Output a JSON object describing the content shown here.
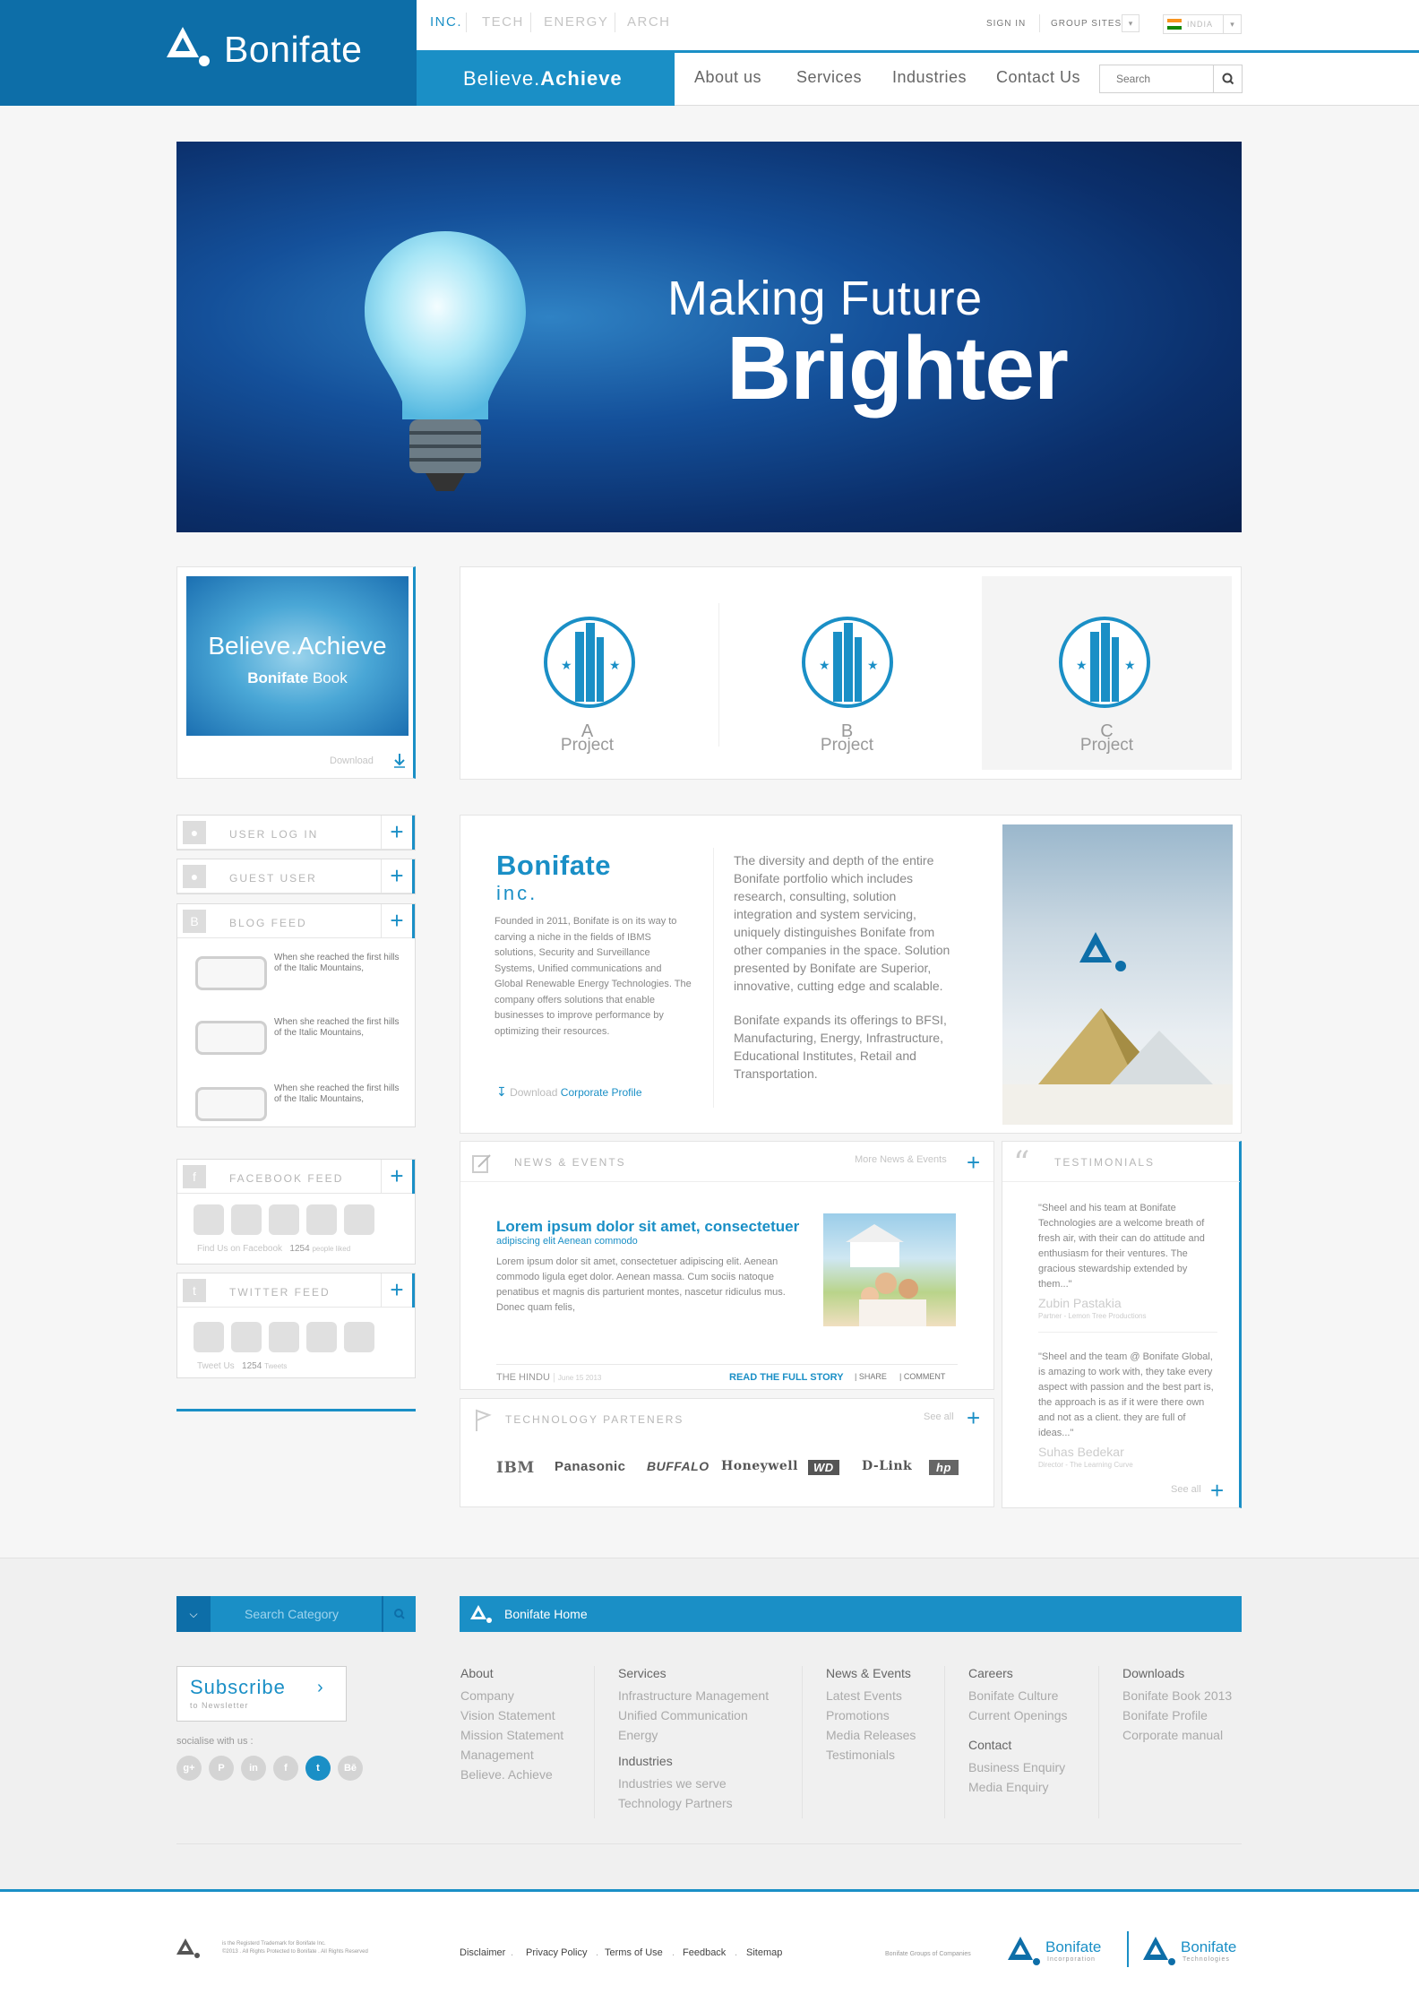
{
  "brand": {
    "name": "Bonifate"
  },
  "topnav": {
    "inc": "INC.",
    "tech": "TECH",
    "energy": "ENERGY",
    "arch": "ARCH"
  },
  "utility": {
    "sign_in": "SIGN IN",
    "group_sites": "GROUP SITES",
    "region": "INDIA"
  },
  "tagline": {
    "believe": "Believe",
    "dot": ".",
    "achieve": "Achieve"
  },
  "mainnav": {
    "about": "About us",
    "services": "Services",
    "industries": "Industries",
    "contact": "Contact Us"
  },
  "search": {
    "placeholder": "Search"
  },
  "hero": {
    "line1": "Making Future",
    "line2": "Brighter"
  },
  "book": {
    "title": "Believe.Achieve",
    "subtitle_bold": "Bonifate",
    "subtitle_rest": " Book",
    "download": "Download"
  },
  "projects": [
    {
      "letter": "A",
      "label": "Project"
    },
    {
      "letter": "B",
      "label": "Project"
    },
    {
      "letter": "C",
      "label": "Project"
    }
  ],
  "widgets": {
    "user_login": "USER LOG IN",
    "guest_user": "GUEST USER",
    "blog_feed": "BLOG FEED",
    "blog_items": [
      "When she reached the first hills of the Italic Mountains,",
      "When she reached the first hills of the Italic Mountains,",
      "When she reached the first hills of the Italic Mountains,"
    ],
    "facebook_feed": "FACEBOOK FEED",
    "facebook_foot": "Find Us on Facebook",
    "facebook_count": "1254",
    "facebook_unit": "people liked",
    "twitter_feed": "TWITTER FEED",
    "twitter_foot": "Tweet Us",
    "twitter_count": "1254",
    "twitter_unit": "Tweets"
  },
  "about": {
    "title": "Bonifate",
    "inc": "inc.",
    "body": "Founded in 2011, Bonifate is on its way to carving a niche in the fields of IBMS solutions, Security and Surveillance Systems, Unified communications and Global Renewable Energy Technologies. The company offers solutions that enable businesses to improve performance by optimizing their resources.",
    "body2a": "The diversity and depth of the entire Bonifate portfolio which includes research, consulting, solution integration and system servicing, uniquely distinguishes Bonifate from other companies in the space. Solution presented by Bonifate are Superior, innovative, cutting edge and scalable.",
    "body2b": "Bonifate expands its offerings to BFSI, Manufacturing, Energy, Infrastructure, Educational Institutes, Retail and Transportation.",
    "download": "Download",
    "download_link": "Corporate Profile"
  },
  "news": {
    "section": "NEWS & EVENTS",
    "more": "More News & Events",
    "headline": "Lorem ipsum dolor sit amet, consectetuer",
    "sub": "adipiscing elit Aenean commodo",
    "body": "Lorem ipsum dolor sit amet, consectetuer adipiscing elit. Aenean commodo ligula eget dolor. Aenean massa. Cum sociis natoque penatibus et magnis dis parturient montes, nascetur ridiculus mus. Donec quam felis,",
    "source": "THE HINDU",
    "date": "June 15 2013",
    "read": "READ THE FULL STORY",
    "share": "SHARE",
    "comment": "COMMENT"
  },
  "partners": {
    "section": "TECHNOLOGY PARTENERS",
    "see_all": "See all",
    "logos": [
      "IBM",
      "Panasonic",
      "BUFFALO",
      "Honeywell",
      "WD",
      "D-Link",
      "hp"
    ]
  },
  "testimonials": {
    "section": "TESTIMONIALS",
    "items": [
      {
        "quote": "\"Sheel and his team at Bonifate Technologies are a welcome breath of fresh air, with their can do attitude and enthusiasm for their ventures. The gracious stewardship extended by them...\"",
        "name": "Zubin Pastakia",
        "role": "Partner - Lemon Tree Productions"
      },
      {
        "quote": "\"Sheel and the team @ Bonifate Global, is amazing to work with, they take every aspect with passion and the best part is, the approach is as if it were there own and not as a client. they are full of ideas...\"",
        "name": "Suhas Bedekar",
        "role": "Director - The Learning Curve"
      }
    ],
    "see_all": "See all"
  },
  "footer": {
    "search_category": "Search Category",
    "home": "Bonifate Home",
    "subscribe": "Subscribe",
    "subscribe_sub": "to Newsletter",
    "socialise": "socialise with us :",
    "social": [
      "g+",
      "P",
      "in",
      "f",
      "t",
      "Bē"
    ],
    "columns": [
      {
        "heading": "About",
        "items": [
          "Company",
          "Vision Statement",
          "Mission Statement",
          "Management",
          "Believe. Achieve"
        ]
      },
      {
        "heading": "Services",
        "items": [
          "Infrastructure Management",
          "Unified Communication",
          "Energy"
        ],
        "heading2": "Industries",
        "items2": [
          "Industries we serve",
          "Technology Partners"
        ]
      },
      {
        "heading": "News & Events",
        "items": [
          "Latest Events",
          "Promotions",
          "Media Releases",
          "Testimonials"
        ]
      },
      {
        "heading": "Careers",
        "items": [
          "Bonifate Culture",
          "Current Openings"
        ],
        "heading2": "Contact",
        "items2": [
          "Business Enquiry",
          "Media Enquiry"
        ]
      },
      {
        "heading": "Downloads",
        "items": [
          "Bonifate Book 2013",
          "Bonifate Profile",
          "Corporate manual"
        ]
      }
    ]
  },
  "bottom": {
    "trademark1": "is the Registerd Trademark for Bonifate Inc.",
    "trademark2": "©2013 . All Rights Protected to Bonifate . All Rights Reserved",
    "links": [
      "Disclaimer",
      "Privacy Policy",
      "Terms of Use",
      "Feedback",
      "Sitemap"
    ],
    "group": "Bonifate Groups of Companies",
    "brand1": "Bonifate",
    "brand1_sub": "Incorporation",
    "brand2": "Bonifate",
    "brand2_sub": "Technologies"
  },
  "colors": {
    "accent": "#1a8fc6",
    "brand_dark": "#0d6ea8",
    "hero": "#0b2f6b"
  }
}
